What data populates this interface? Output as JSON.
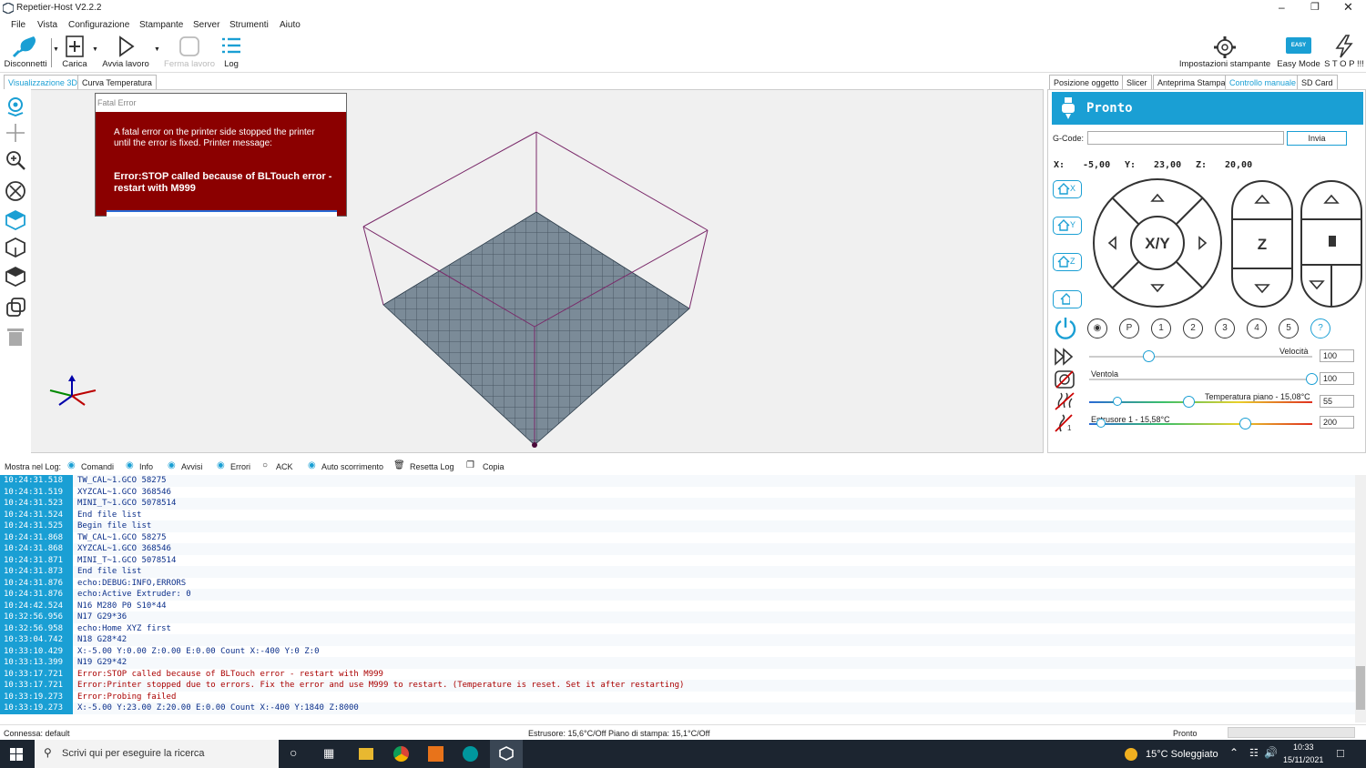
{
  "window": {
    "title": "Repetier-Host V2.2.2"
  },
  "menu": [
    "File",
    "Vista",
    "Configurazione",
    "Stampante",
    "Server",
    "Strumenti",
    "Aiuto"
  ],
  "toolbar": {
    "disconnect": "Disconnetti",
    "load": "Carica",
    "start": "Avvia lavoro",
    "stop_job": "Ferma lavoro",
    "log": "Log",
    "printer_settings": "Impostazioni stampante",
    "easy_mode": "Easy Mode",
    "easy_badge": "EASY",
    "stop": "S T O P !!!"
  },
  "left_tabs": [
    "Visualizzazione 3D",
    "Curva Temperatura"
  ],
  "right_tabs": [
    "Posizione oggetto",
    "Slicer",
    "Anteprima Stampa",
    "Controllo manuale",
    "SD Card"
  ],
  "fatal": {
    "title": "Fatal Error",
    "message": "A fatal error on the printer side stopped the printer until the error is fixed. Printer message:",
    "error": "Error:STOP called because of BLTouch error - restart with M999"
  },
  "control": {
    "status": "Pronto",
    "gcode_label": "G-Code:",
    "gcode_value": "",
    "send": "Invia",
    "x_label": "X:",
    "x": "-5,00",
    "y_label": "Y:",
    "y": "23,00",
    "z_label": "Z:",
    "z": "20,00",
    "home_x": "X",
    "home_y": "Y",
    "home_z": "Z",
    "xy": "X/Y",
    "zlbl": "Z",
    "presets": [
      "P",
      "1",
      "2",
      "3",
      "4",
      "5",
      "?"
    ],
    "speed_label": "Velocità",
    "speed": "100",
    "fan_label": "Ventola",
    "fan": "100",
    "bed_label": "Temperatura piano - 15,08°C",
    "bed": "55",
    "ext_label": "Estrusore 1 - 15,58°C",
    "ext": "200",
    "speed_fraction": 0.27,
    "fan_fraction": 1.0,
    "bed_fraction": 0.45,
    "ext_fraction": 0.7
  },
  "logbar": {
    "show": "Mostra nel Log:",
    "commands": "Comandi",
    "info": "Info",
    "warnings": "Avvisi",
    "errors": "Errori",
    "ack": "ACK",
    "autoscroll": "Auto scorrimento",
    "reset": "Resetta Log",
    "copy": "Copia"
  },
  "log": [
    {
      "t": "10:24:31.518",
      "m": "TW_CAL~1.GCO 58275",
      "e": false
    },
    {
      "t": "10:24:31.519",
      "m": "XYZCAL~1.GCO 368546",
      "e": false
    },
    {
      "t": "10:24:31.523",
      "m": "MINI_T~1.GCO 5078514",
      "e": false
    },
    {
      "t": "10:24:31.524",
      "m": "End file list",
      "e": false
    },
    {
      "t": "10:24:31.525",
      "m": "Begin file list",
      "e": false
    },
    {
      "t": "10:24:31.868",
      "m": "TW_CAL~1.GCO 58275",
      "e": false
    },
    {
      "t": "10:24:31.868",
      "m": "XYZCAL~1.GCO 368546",
      "e": false
    },
    {
      "t": "10:24:31.871",
      "m": "MINI_T~1.GCO 5078514",
      "e": false
    },
    {
      "t": "10:24:31.873",
      "m": "End file list",
      "e": false
    },
    {
      "t": "10:24:31.876",
      "m": "echo:DEBUG:INFO,ERRORS",
      "e": false
    },
    {
      "t": "10:24:31.876",
      "m": "echo:Active Extruder: 0",
      "e": false
    },
    {
      "t": "10:24:42.524",
      "m": "N16 M280 P0 S10*44",
      "e": false
    },
    {
      "t": "10:32:56.956",
      "m": "N17 G29*36",
      "e": false
    },
    {
      "t": "10:32:56.958",
      "m": "echo:Home XYZ first",
      "e": false
    },
    {
      "t": "10:33:04.742",
      "m": "N18 G28*42",
      "e": false
    },
    {
      "t": "10:33:10.429",
      "m": "X:-5.00 Y:0.00 Z:0.00 E:0.00 Count X:-400 Y:0 Z:0",
      "e": false
    },
    {
      "t": "10:33:13.399",
      "m": "N19 G29*42",
      "e": false
    },
    {
      "t": "10:33:17.721",
      "m": "Error:STOP called because of BLTouch error - restart with M999",
      "e": true
    },
    {
      "t": "10:33:17.721",
      "m": "Error:Printer stopped due to errors. Fix the error and use M999 to restart. (Temperature is reset. Set it after restarting)",
      "e": true
    },
    {
      "t": "10:33:19.273",
      "m": "Error:Probing failed",
      "e": true
    },
    {
      "t": "10:33:19.273",
      "m": "X:-5.00 Y:23.00 Z:20.00 E:0.00 Count X:-400 Y:1840 Z:8000",
      "e": false
    }
  ],
  "status": {
    "connection": "Connessa: default",
    "temps": "Estrusore: 15,6°C/Off Piano di stampa: 15,1°C/Off",
    "state": "Pronto"
  },
  "taskbar": {
    "search": "Scrivi qui per eseguire la ricerca",
    "weather": "15°C  Soleggiato",
    "time": "10:33",
    "date": "15/11/2021"
  },
  "colors": {
    "accent": "#1a9fd4",
    "error_bg": "#8b0000",
    "log_text": "#0b2f8a",
    "log_error": "#aa0000"
  }
}
